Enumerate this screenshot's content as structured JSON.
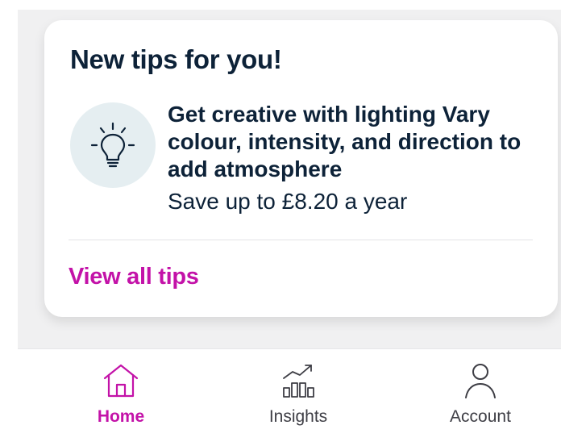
{
  "tips_card": {
    "title": "New tips for you!",
    "tip_text": "Get creative with lighting Vary colour, intensity, and direction to add atmosphere",
    "saving": "Save up to £8.20 a year",
    "view_all_label": "View all tips",
    "icon": "lightbulb-icon"
  },
  "bottom_nav": {
    "items": [
      {
        "label": "Home",
        "icon": "home-icon",
        "active": true
      },
      {
        "label": "Insights",
        "icon": "bar-chart-trend-icon",
        "active": false
      },
      {
        "label": "Account",
        "icon": "person-icon",
        "active": false
      }
    ]
  },
  "colors": {
    "accent": "#c312a8",
    "text_dark": "#0d2238",
    "icon_circle_bg": "#e5eef1",
    "background": "#f0f0f1"
  }
}
